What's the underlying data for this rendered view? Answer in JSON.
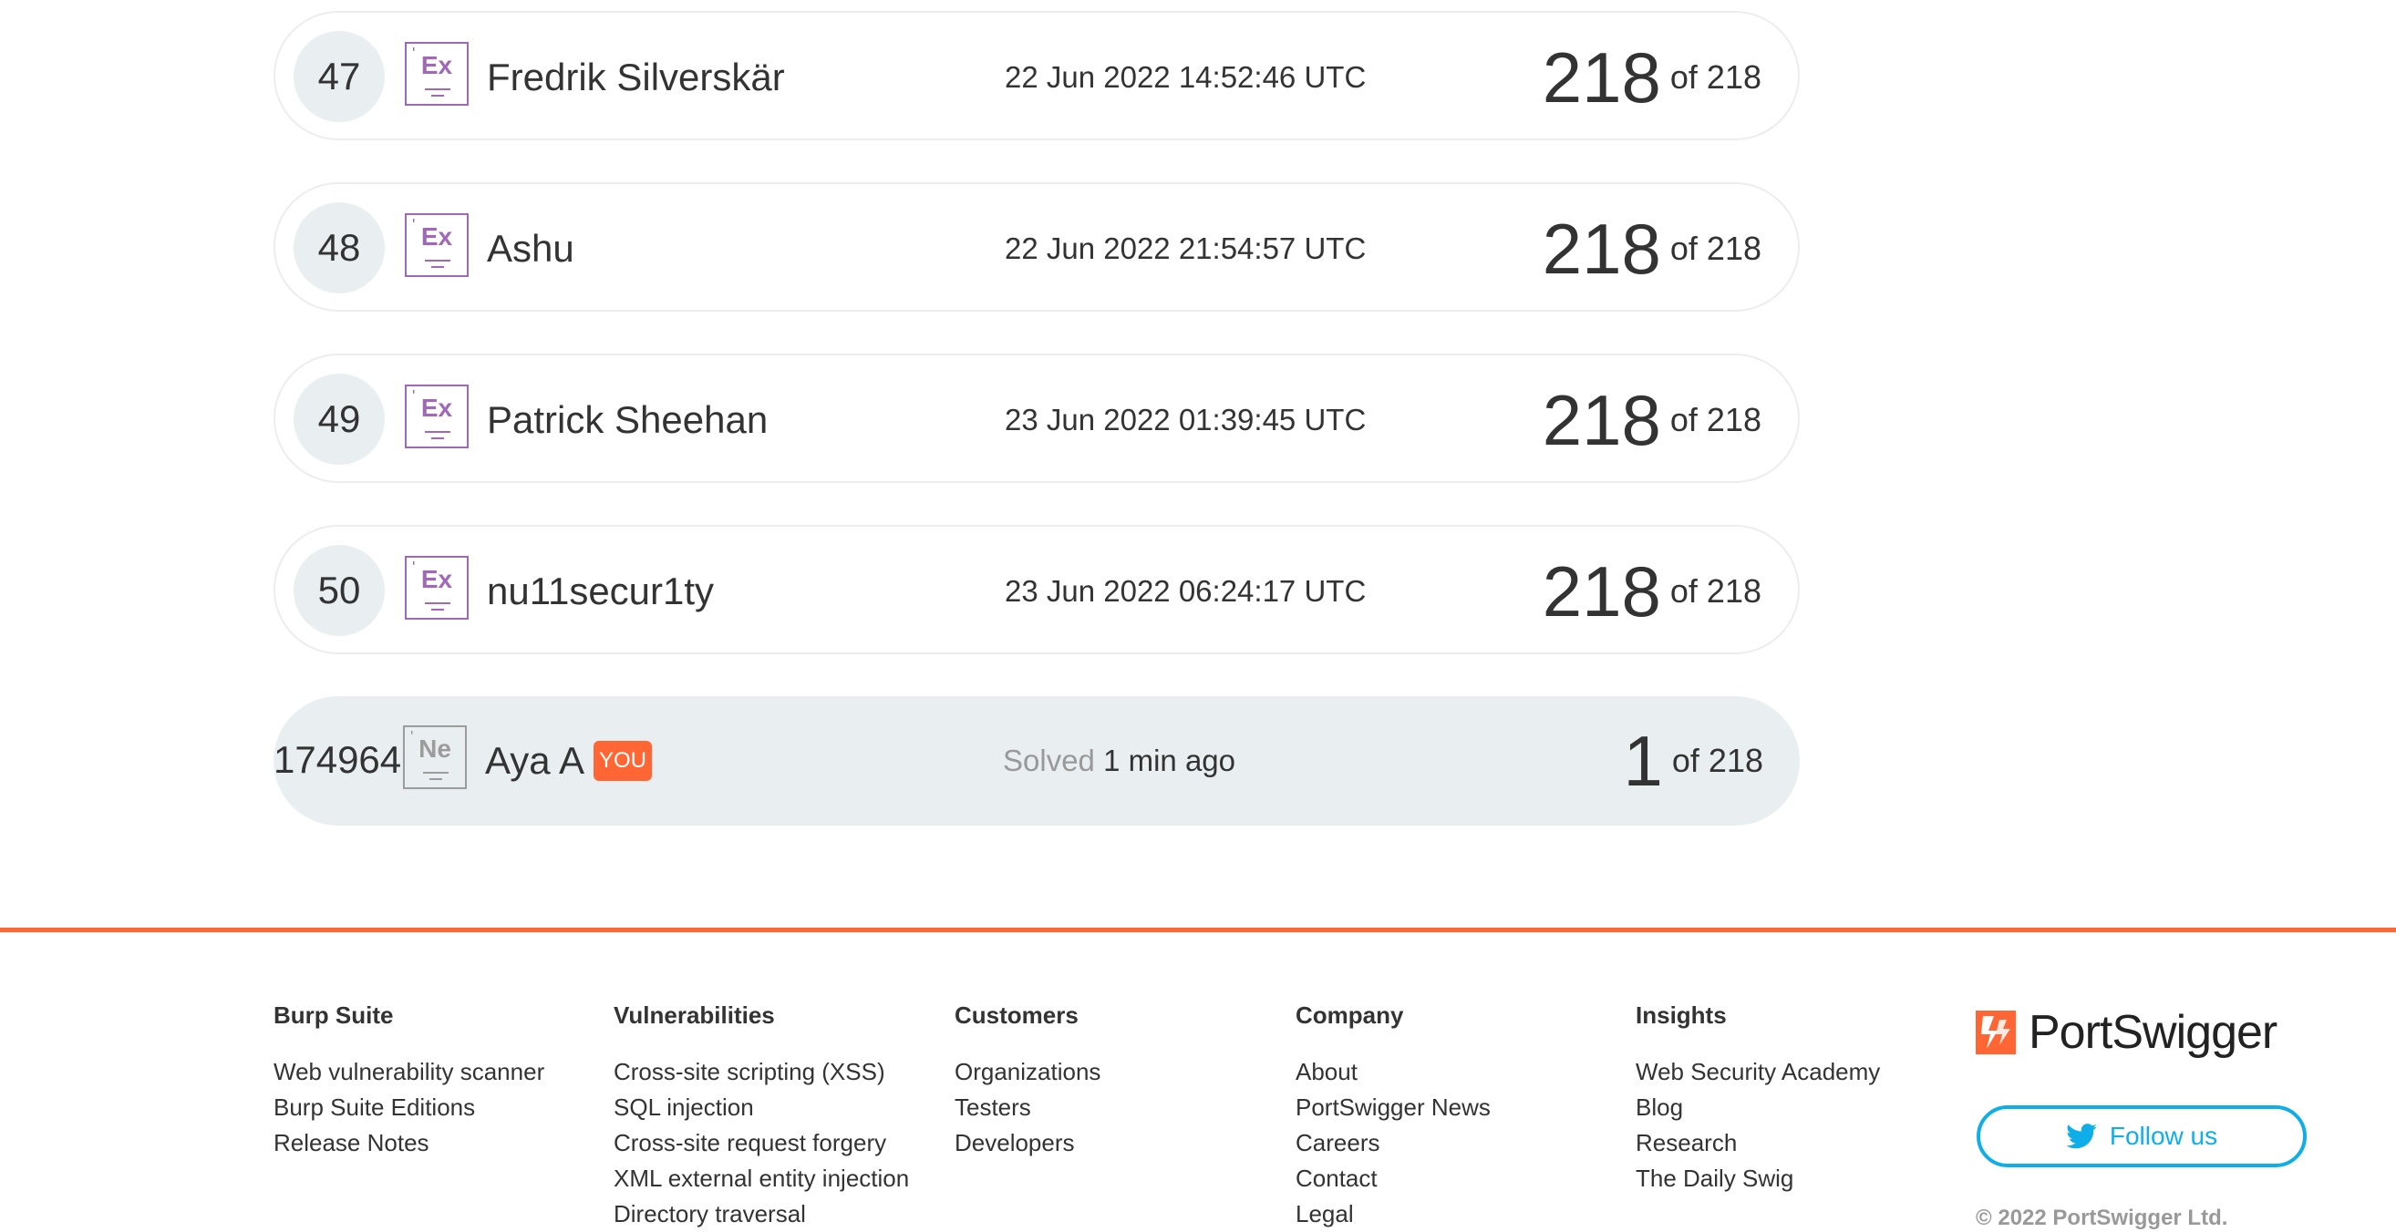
{
  "leaderboard": {
    "rows": [
      {
        "rank": "47",
        "level": "Ex",
        "name": "Fredrik Silverskär",
        "time": "22 Jun 2022 14:52:46 UTC",
        "score": "218",
        "of": "of 218"
      },
      {
        "rank": "48",
        "level": "Ex",
        "name": "Ashu",
        "time": "22 Jun 2022 21:54:57 UTC",
        "score": "218",
        "of": "of 218"
      },
      {
        "rank": "49",
        "level": "Ex",
        "name": "Patrick Sheehan",
        "time": "23 Jun 2022 01:39:45 UTC",
        "score": "218",
        "of": "of 218"
      },
      {
        "rank": "50",
        "level": "Ex",
        "name": "nu11secur1ty",
        "time": "23 Jun 2022 06:24:17 UTC",
        "score": "218",
        "of": "of 218"
      }
    ],
    "you": {
      "rank": "174964",
      "level": "Ne",
      "name": "Aya A",
      "badge": "YOU",
      "solved_prefix": "Solved",
      "solved_time": "1 min ago",
      "score": "1",
      "of": "of 218"
    }
  },
  "footer": {
    "columns": [
      {
        "title": "Burp Suite",
        "links": [
          "Web vulnerability scanner",
          "Burp Suite Editions",
          "Release Notes"
        ]
      },
      {
        "title": "Vulnerabilities",
        "links": [
          "Cross-site scripting (XSS)",
          "SQL injection",
          "Cross-site request forgery",
          "XML external entity injection",
          "Directory traversal"
        ]
      },
      {
        "title": "Customers",
        "links": [
          "Organizations",
          "Testers",
          "Developers"
        ]
      },
      {
        "title": "Company",
        "links": [
          "About",
          "PortSwigger News",
          "Careers",
          "Contact",
          "Legal"
        ]
      },
      {
        "title": "Insights",
        "links": [
          "Web Security Academy",
          "Blog",
          "Research",
          "The Daily Swig"
        ]
      }
    ],
    "brand": "PortSwigger",
    "follow_label": "Follow us",
    "copyright": "© 2022 PortSwigger Ltd."
  },
  "colors": {
    "accent": "#ff6633",
    "expert_level": "#a168b8",
    "twitter": "#0faee8",
    "you_row": "#e9eef0"
  },
  "icons": [
    "level-badge-icon",
    "portswigger-logo-icon",
    "twitter-bird-icon"
  ]
}
